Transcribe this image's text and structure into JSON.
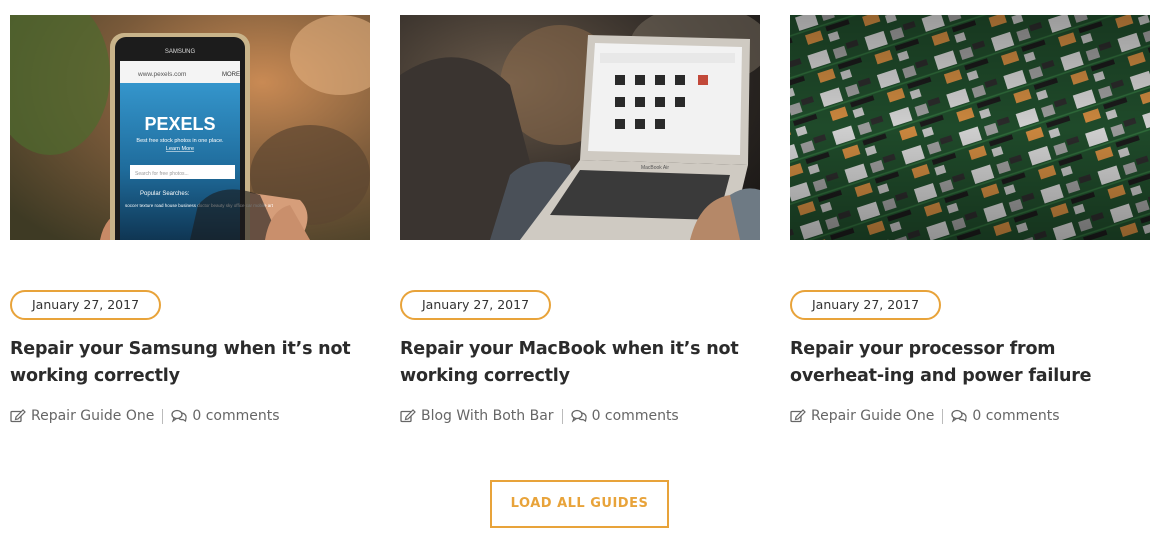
{
  "guides": [
    {
      "image_alt": "Person holding a Samsung phone showing the Pexels website",
      "image_text": {
        "brand": "SAMSUNG",
        "url": "www.pexels.com",
        "menu": "MORE",
        "logo": "PEXELS",
        "tagline": "Best free stock photos in one place.",
        "learn_more": "Learn More",
        "search_placeholder": "Search for free photos...",
        "popular": "Popular Searches:",
        "tags": "soccer  texture  road  house  business  doctor  beauty  sky  office  car  mobile  art"
      },
      "date": "January 27, 2017",
      "title": "Repair your Samsung when it’s not working correctly",
      "category": "Repair Guide One",
      "comments": "0 comments"
    },
    {
      "image_alt": "Person using a MacBook laptop",
      "image_text": {
        "laptop_label": "MacBook Air"
      },
      "date": "January 27, 2017",
      "title": "Repair your MacBook when it’s not working correctly",
      "category": "Blog With Both Bar",
      "comments": "0 comments"
    },
    {
      "image_alt": "Rows of circuit boards with processors",
      "image_text": {},
      "date": "January 27, 2017",
      "title": "Repair your processor from overheat-ing and power failure",
      "category": "Repair Guide One",
      "comments": "0 comments"
    }
  ],
  "load_button": "LOAD ALL GUIDES",
  "colors": {
    "accent": "#e8a33a",
    "text": "#2b2b2b",
    "meta": "#666666"
  },
  "icons": {
    "category": "edit-icon",
    "comments": "comments-icon"
  }
}
